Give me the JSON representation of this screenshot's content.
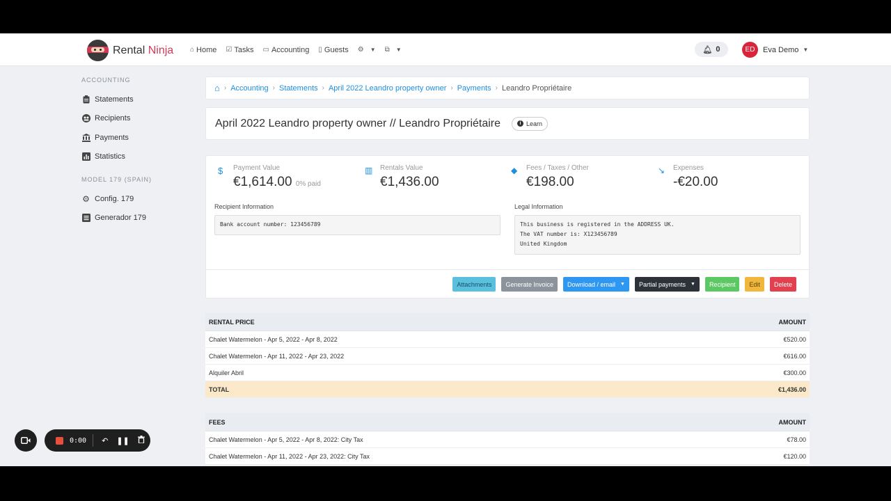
{
  "app": {
    "brand_a": "Rental",
    "brand_b": "Ninja"
  },
  "nav": [
    {
      "icon": "home-icon",
      "label": "Home"
    },
    {
      "icon": "tasks-icon",
      "label": "Tasks"
    },
    {
      "icon": "accounting-icon",
      "label": "Accounting"
    },
    {
      "icon": "guests-icon",
      "label": "Guests"
    }
  ],
  "notifications": {
    "count": "0"
  },
  "user": {
    "initials": "ED",
    "name": "Eva Demo"
  },
  "sidebar": {
    "section1": "ACCOUNTING",
    "items1": [
      {
        "icon": "clipboard-icon",
        "label": "Statements"
      },
      {
        "icon": "recipients-icon",
        "label": "Recipients"
      },
      {
        "icon": "bank-icon",
        "label": "Payments"
      },
      {
        "icon": "statistics-icon",
        "label": "Statistics"
      }
    ],
    "section2": "MODEL 179 (SPAIN)",
    "items2": [
      {
        "icon": "gear-icon",
        "label": "Config. 179"
      },
      {
        "icon": "list-icon",
        "label": "Generador 179"
      }
    ]
  },
  "breadcrumb": {
    "items": [
      "Accounting",
      "Statements",
      "April 2022 Leandro property owner",
      "Payments"
    ],
    "current": "Leandro Propriétaire"
  },
  "page": {
    "title": "April 2022 Leandro property owner // Leandro Propriétaire",
    "learn": "Learn"
  },
  "stats": [
    {
      "icon": "dollar-icon",
      "label": "Payment Value",
      "value": "€1,614.00",
      "note": "0% paid",
      "color": "#1d8ee0"
    },
    {
      "icon": "building-icon",
      "label": "Rentals Value",
      "value": "€1,436.00",
      "note": "",
      "color": "#1d8ee0"
    },
    {
      "icon": "tag-icon",
      "label": "Fees / Taxes / Other",
      "value": "€198.00",
      "note": "",
      "color": "#1d8ee0"
    },
    {
      "icon": "trending-down-icon",
      "label": "Expenses",
      "value": "-€20.00",
      "note": "",
      "color": "#1d8ee0"
    }
  ],
  "recipient_info": {
    "label": "Recipient Information",
    "text": "Bank account number: 123456789"
  },
  "legal_info": {
    "label": "Legal Information",
    "text": "This business is registered in the ADDRESS UK.\nThe VAT number is: X123456789\nUnited Kingdom"
  },
  "actions": [
    {
      "label": "Attachments",
      "color": "#5bc0de",
      "text_color": "#14506b",
      "caret": false
    },
    {
      "label": "Generate Invoice",
      "color": "#8b949c",
      "text_color": "#ffffff",
      "caret": false
    },
    {
      "label": "Download / email",
      "color": "#2e97f1",
      "text_color": "#ffffff",
      "caret": true
    },
    {
      "label": "Partial payments",
      "color": "#2d3238",
      "text_color": "#ffffff",
      "caret": true
    },
    {
      "label": "Recipient",
      "color": "#5cc864",
      "text_color": "#ffffff",
      "caret": false
    },
    {
      "label": "Edit",
      "color": "#f0b73c",
      "text_color": "#5a4300",
      "caret": false
    },
    {
      "label": "Delete",
      "color": "#e2404f",
      "text_color": "#ffffff",
      "caret": false
    }
  ],
  "rental_table": {
    "header": "RENTAL PRICE",
    "amount_header": "AMOUNT",
    "rows": [
      {
        "desc": "Chalet Watermelon - Apr 5, 2022 - Apr 8, 2022",
        "amount": "€520.00"
      },
      {
        "desc": "Chalet Watermelon - Apr 11, 2022 - Apr 23, 2022",
        "amount": "€616.00"
      },
      {
        "desc": "Alquiler Abril",
        "amount": "€300.00"
      }
    ],
    "total_label": "TOTAL",
    "total": "€1,436.00"
  },
  "fees_table": {
    "header": "FEES",
    "amount_header": "AMOUNT",
    "rows": [
      {
        "desc": "Chalet Watermelon - Apr 5, 2022 - Apr 8, 2022: City Tax",
        "amount": "€78.00"
      },
      {
        "desc": "Chalet Watermelon - Apr 11, 2022 - Apr 23, 2022: City Tax",
        "amount": "€120.00"
      }
    ]
  },
  "recorder": {
    "time": "0:00"
  }
}
